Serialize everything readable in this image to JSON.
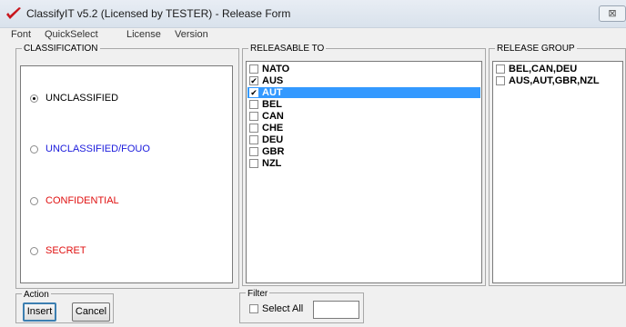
{
  "window": {
    "title": "ClassifyIT v5.2 (Licensed by TESTER) - Release Form",
    "close_glyph": "⊠"
  },
  "menu": [
    "Font",
    "QuickSelect",
    "License",
    "Version"
  ],
  "classification": {
    "legend": "CLASSIFICATION",
    "options": [
      {
        "label": "UNCLASSIFIED",
        "color": "#000000",
        "selected": true
      },
      {
        "label": "UNCLASSIFIED/FOUO",
        "color": "#1a1adc",
        "selected": false
      },
      {
        "label": "CONFIDENTIAL",
        "color": "#e01010",
        "selected": false
      },
      {
        "label": "SECRET",
        "color": "#e01010",
        "selected": false
      }
    ]
  },
  "releasable_to": {
    "legend": "RELEASABLE TO",
    "items": [
      {
        "label": "NATO",
        "checked": false,
        "selected": false
      },
      {
        "label": "AUS",
        "checked": true,
        "selected": false
      },
      {
        "label": "AUT",
        "checked": true,
        "selected": true
      },
      {
        "label": "BEL",
        "checked": false,
        "selected": false
      },
      {
        "label": "CAN",
        "checked": false,
        "selected": false
      },
      {
        "label": "CHE",
        "checked": false,
        "selected": false
      },
      {
        "label": "DEU",
        "checked": false,
        "selected": false
      },
      {
        "label": "GBR",
        "checked": false,
        "selected": false
      },
      {
        "label": "NZL",
        "checked": false,
        "selected": false
      }
    ]
  },
  "release_group": {
    "legend": "RELEASE GROUP",
    "items": [
      {
        "label": "BEL,CAN,DEU",
        "checked": false
      },
      {
        "label": "AUS,AUT,GBR,NZL",
        "checked": false
      }
    ]
  },
  "action": {
    "legend": "Action",
    "insert_label": "Insert",
    "cancel_label": "Cancel"
  },
  "filter": {
    "legend": "Filter",
    "select_all_label": "Select All",
    "select_all_checked": false,
    "value": ""
  }
}
